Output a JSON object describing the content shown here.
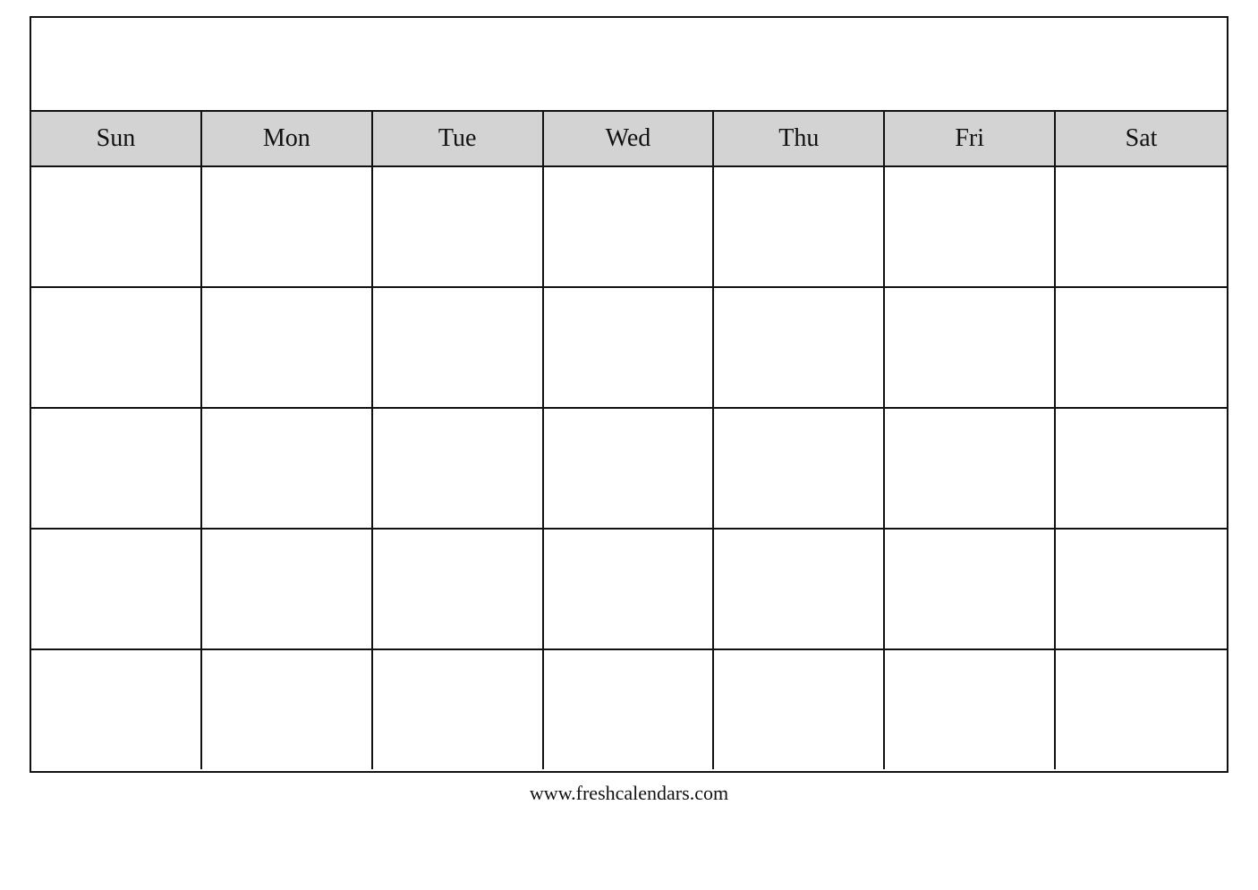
{
  "calendar": {
    "title": "",
    "days": [
      "Sun",
      "Mon",
      "Tue",
      "Wed",
      "Thu",
      "Fri",
      "Sat"
    ],
    "rows": 5,
    "footer": "www.freshcalendars.com"
  }
}
